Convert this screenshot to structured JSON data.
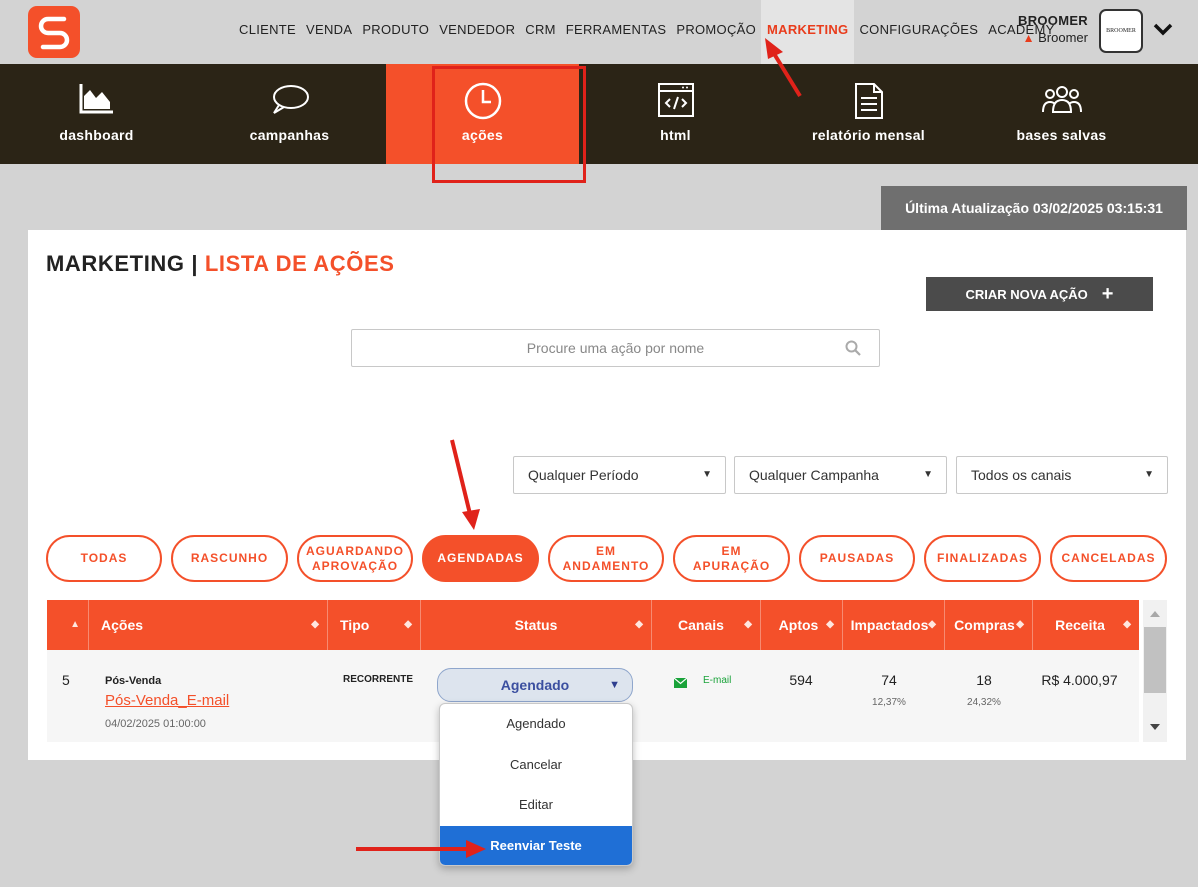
{
  "topnav": {
    "items": [
      "CLIENTE",
      "VENDA",
      "PRODUTO",
      "VENDEDOR",
      "CRM",
      "FERRAMENTAS",
      "PROMOÇÃO",
      "MARKETING",
      "CONFIGURAÇÕES",
      "ACADEMY"
    ],
    "active": "MARKETING",
    "user_name": "BROOMER",
    "user_store": "Broomer",
    "avatar_text": "BROOMER"
  },
  "modules": [
    "dashboard",
    "campanhas",
    "ações",
    "html",
    "relatório mensal",
    "bases salvas"
  ],
  "active_module": "ações",
  "update_text": "Última Atualização 03/02/2025 03:15:31",
  "page": {
    "title_left": "MARKETING",
    "title_sep": " | ",
    "title_right": "LISTA DE AÇÕES",
    "create_button": "CRIAR NOVA AÇÃO",
    "search_placeholder": "Procure uma ação por nome"
  },
  "filters": {
    "period": "Qualquer Período",
    "campaign": "Qualquer Campanha",
    "channel": "Todos os canais"
  },
  "status_tabs": [
    {
      "line1": "TODAS",
      "line2": ""
    },
    {
      "line1": "RASCUNHO",
      "line2": ""
    },
    {
      "line1": "AGUARDANDO",
      "line2": "APROVAÇÃO"
    },
    {
      "line1": "AGENDADAS",
      "line2": ""
    },
    {
      "line1": "EM",
      "line2": "ANDAMENTO"
    },
    {
      "line1": "EM",
      "line2": "APURAÇÃO"
    },
    {
      "line1": "PAUSADAS",
      "line2": ""
    },
    {
      "line1": "FINALIZADAS",
      "line2": ""
    },
    {
      "line1": "CANCELADAS",
      "line2": ""
    }
  ],
  "table": {
    "headers": [
      "Ações",
      "Tipo",
      "Status",
      "Canais",
      "Aptos",
      "Impactados",
      "Compras",
      "Receita"
    ],
    "row": {
      "id": "5",
      "category": "Pós-Venda",
      "name": "Pós-Venda_E-mail",
      "date": "04/02/2025 01:00:00",
      "type": "RECORRENTE",
      "status": "Agendado",
      "channel": "E-mail",
      "aptos": "594",
      "impactados": "74",
      "impactados_pct": "12,37%",
      "compras": "18",
      "compras_pct": "24,32%",
      "receita": "R$ 4.000,97"
    }
  },
  "status_menu": {
    "options": [
      "Agendado",
      "Cancelar",
      "Editar",
      "Reenviar Teste"
    ],
    "highlighted": "Reenviar Teste"
  },
  "colors": {
    "brand": "#f4502a",
    "dark_bar": "#2b2416",
    "highlight": "#1f6fd6",
    "annotation": "#e0221a"
  }
}
